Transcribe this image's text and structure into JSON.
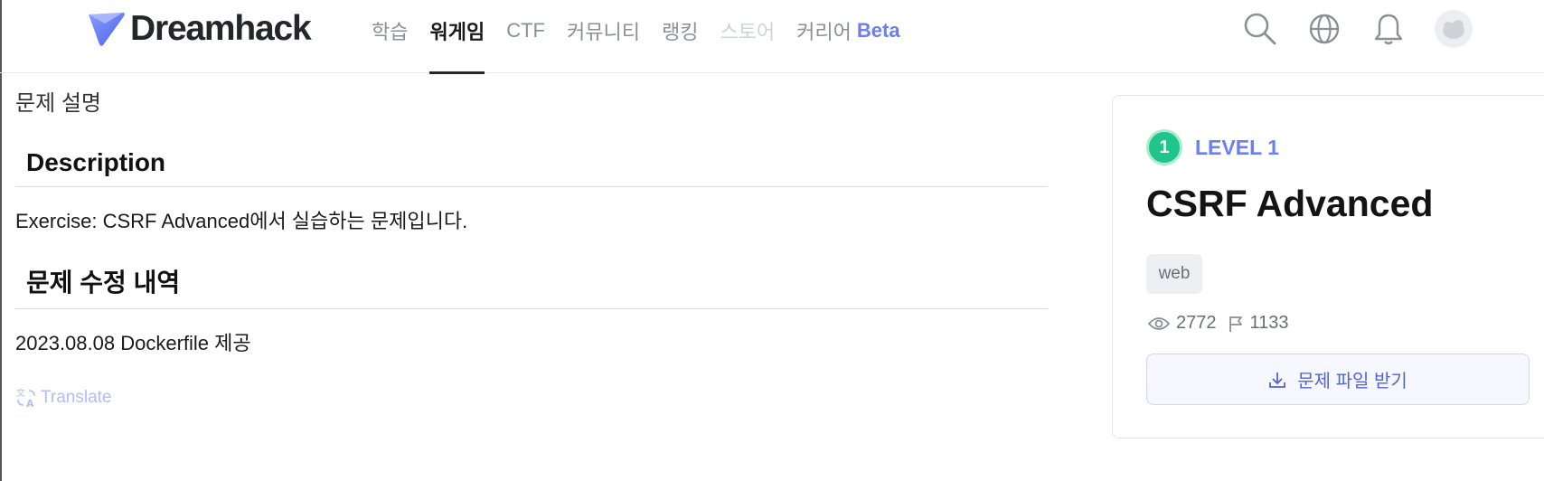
{
  "header": {
    "logo_text": "Dreamhack",
    "nav": [
      {
        "label": "학습",
        "state": "normal"
      },
      {
        "label": "워게임",
        "state": "active"
      },
      {
        "label": "CTF",
        "state": "normal"
      },
      {
        "label": "커뮤니티",
        "state": "normal"
      },
      {
        "label": "랭킹",
        "state": "normal"
      },
      {
        "label": "스토어",
        "state": "disabled"
      },
      {
        "label": "커리어",
        "state": "normal",
        "badge": "Beta"
      }
    ],
    "icons": [
      "search-icon",
      "globe-icon",
      "bell-icon",
      "avatar"
    ]
  },
  "main": {
    "section_label": "문제 설명",
    "description_heading": "Description",
    "description_text": "Exercise: CSRF Advanced에서 실습하는 문제입니다.",
    "changelog_heading": "문제 수정 내역",
    "changelog_text": "2023.08.08 Dockerfile 제공",
    "translate_label": "Translate"
  },
  "card": {
    "level_number": "1",
    "level_label": "LEVEL 1",
    "title": "CSRF Advanced",
    "tag": "web",
    "views": "2772",
    "solves": "1133",
    "download_label": "문제 파일 받기"
  },
  "colors": {
    "accent": "#6c7ef0",
    "level_green": "#21c48b",
    "text": "#1a1a1a",
    "muted": "#8a8f98"
  }
}
